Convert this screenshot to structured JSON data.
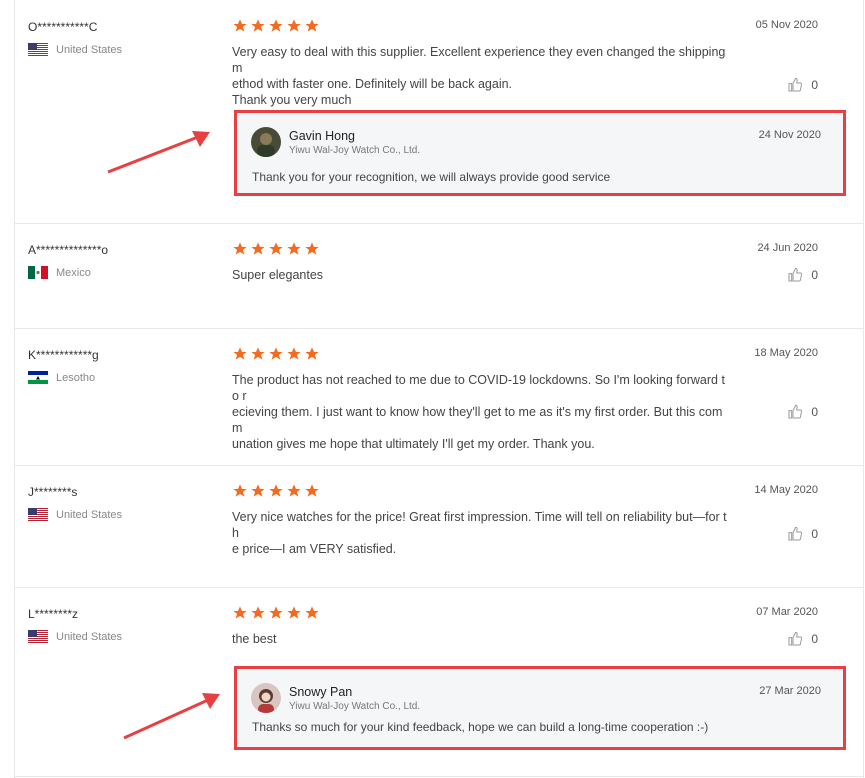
{
  "reviews": [
    {
      "name": "O***********C",
      "country": "United States",
      "flag": "us",
      "date": "05 Nov 2020",
      "text": "Very easy to deal with this supplier. Excellent experience they even changed the shipping m\nethod with faster one. Definitely will be back again.\nThank you very much",
      "likes": "0",
      "reply": {
        "name": "Gavin Hong",
        "company": "Yiwu Wal-Joy Watch Co., Ltd.",
        "date": "24 Nov 2020",
        "text": "Thank you for your recognition, we will always provide good service"
      }
    },
    {
      "name": "A**************o",
      "country": "Mexico",
      "flag": "mx",
      "date": "24 Jun 2020",
      "text": "Super elegantes",
      "likes": "0"
    },
    {
      "name": "K************g",
      "country": "Lesotho",
      "flag": "ls",
      "date": "18 May 2020",
      "text": "The product has not reached to me due to COVID-19 lockdowns. So I'm looking forward to r\necieving them. I just want to know how they'll get to me as it's my first order. But this comm\nunation gives me hope that ultimately I'll get my order. Thank you.",
      "likes": "0"
    },
    {
      "name": "J********s",
      "country": "United States",
      "flag": "us",
      "date": "14 May 2020",
      "text": "Very nice watches for the price! Great first impression. Time will tell on reliability but—for th\ne price—I am VERY satisfied.",
      "likes": "0"
    },
    {
      "name": "L********z",
      "country": "United States",
      "flag": "us",
      "date": "07 Mar 2020",
      "text": "the best",
      "likes": "0",
      "reply": {
        "name": "Snowy Pan",
        "company": "Yiwu Wal-Joy Watch Co., Ltd.",
        "date": "27 Mar 2020",
        "text": "Thanks so much for your kind feedback, hope we can build a long-time cooperation :-)"
      }
    }
  ],
  "colors": {
    "star": "#f46a1e",
    "highlight": "#e84040"
  }
}
